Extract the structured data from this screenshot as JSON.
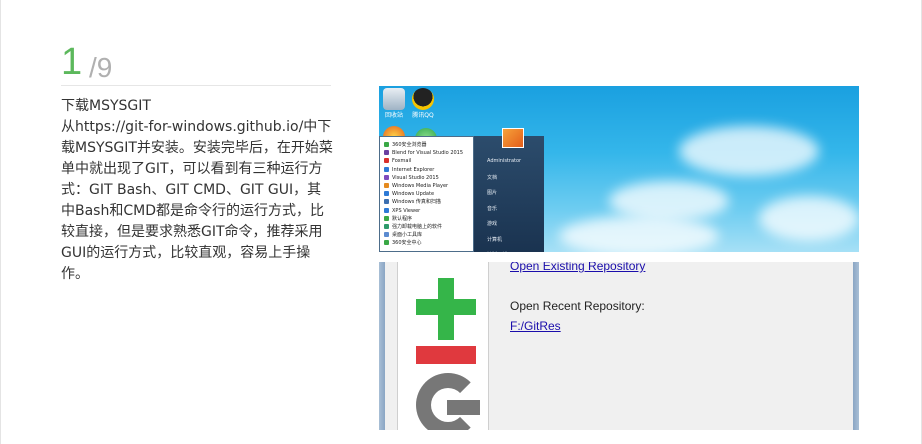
{
  "step": {
    "current": "1",
    "total": "/9"
  },
  "text": {
    "title": "下载MSYSGIT",
    "body": "从https://git-for-windows.github.io/中下载MSYSGIT并安装。安装完毕后，在开始菜单中就出现了GIT，可以看到有三种运行方式：GIT Bash、GIT CMD、GIT GUI，其中Bash和CMD都是命令行的运行方式，比较直接，但是要求熟悉GIT命令，推荐采用GUI的运行方式，比较直观，容易上手操作。"
  },
  "desktop_screenshot": {
    "start_menu_items": [
      "360安全浏览器",
      "Blend for Visual Studio 2015",
      "Foxmail",
      "Internet Explorer",
      "Visual Studio 2015",
      "Windows Media Player",
      "Windows Update",
      "Windows 传真和扫描",
      "XPS Viewer",
      "默认程序",
      "强力卸载电脑上的软件",
      "桌面小工具库",
      "360安全中心"
    ],
    "start_menu_item_colors": [
      "#3aa845",
      "#6a3fa0",
      "#d9302c",
      "#2d7ad6",
      "#7e4bbd",
      "#e58a1f",
      "#2d7ad6",
      "#3c6fb0",
      "#2d7ad6",
      "#3aa845",
      "#2d9a6a",
      "#5b8bd0",
      "#3aa845"
    ],
    "start_menu_right_items": [
      "Administrator",
      "文档",
      "图片",
      "音乐",
      "游戏",
      "计算机",
      "控制面板"
    ]
  },
  "gitgui_screenshot": {
    "open_existing": "Open Existing Repository",
    "open_recent_label": "Open Recent Repository:",
    "recent_repo": "F:/GitRes"
  },
  "colors": {
    "accent": "#5cb85c",
    "total": "#b0b0b0",
    "git_green": "#35b549",
    "git_red": "#e0393e",
    "git_gray": "#777777",
    "link": "#1a0dab"
  }
}
